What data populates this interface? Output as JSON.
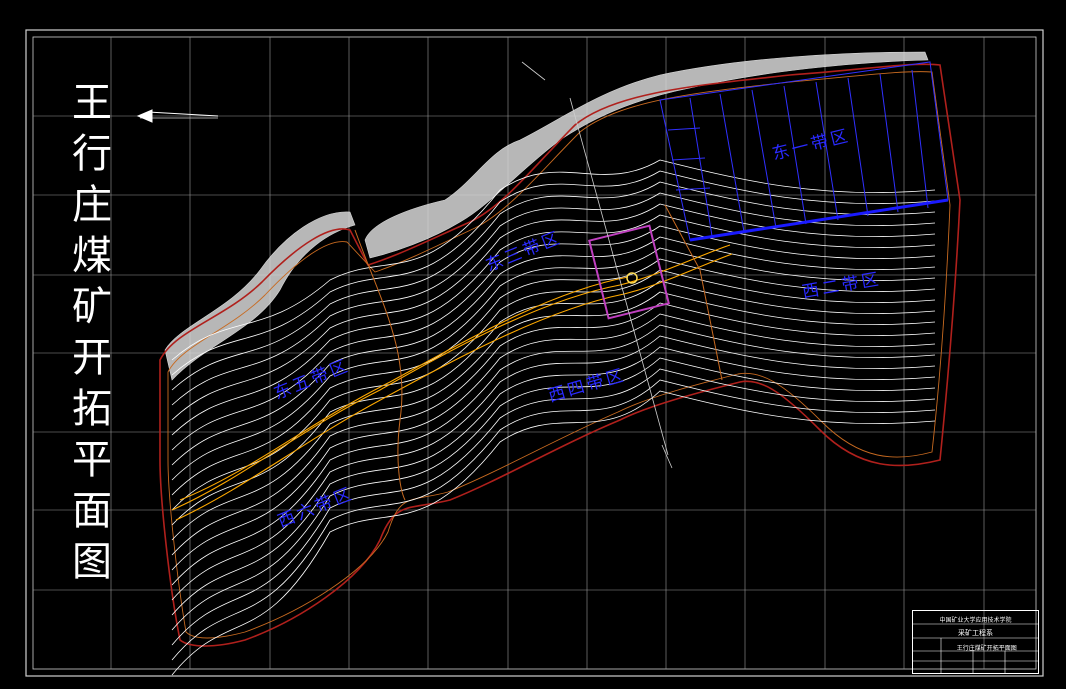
{
  "title_chars": [
    "王",
    "行",
    "庄",
    "煤",
    "矿",
    "开",
    "拓",
    "平",
    "面",
    "图"
  ],
  "zones": [
    {
      "id": "zone-1",
      "label": "东一带区"
    },
    {
      "id": "zone-2",
      "label": "西二带区"
    },
    {
      "id": "zone-3",
      "label": "东三带区"
    },
    {
      "id": "zone-4",
      "label": "西四带区"
    },
    {
      "id": "zone-5",
      "label": "东五带区"
    },
    {
      "id": "zone-6",
      "label": "西六带区"
    }
  ],
  "title_block": {
    "line1": "中国矿业大学应用技术学院",
    "line2": "采矿工程系",
    "line3": "王行庄煤矿开拓平面图"
  },
  "colors": {
    "background": "#000000",
    "grid": "#bfbfbf",
    "contours": "#ffffff",
    "zones": "#2a2aff",
    "roadway": "#ffaa00",
    "boundary": "#b0201c",
    "shaft": "#c040c0"
  }
}
